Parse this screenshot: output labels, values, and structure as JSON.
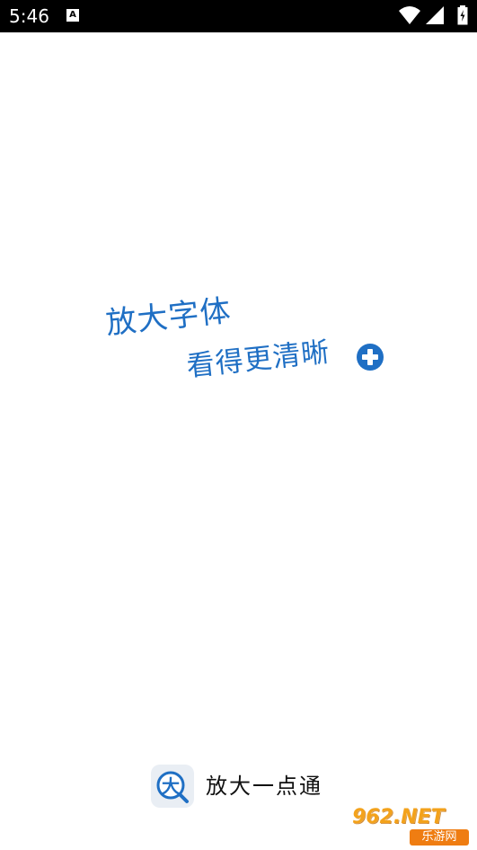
{
  "status_bar": {
    "time": "5:46",
    "notification_icon_letter": "A",
    "icons": [
      "wifi-icon",
      "signal-icon",
      "battery-icon"
    ]
  },
  "slogan": {
    "line1": "放大字体",
    "line2": "看得更清晰",
    "accent_color": "#1f6fc4",
    "icon": "plus-circle-icon"
  },
  "brand": {
    "logo_char": "大",
    "name": "放大一点通"
  },
  "watermark": {
    "top": "962.NET",
    "bottom": "乐游网"
  }
}
